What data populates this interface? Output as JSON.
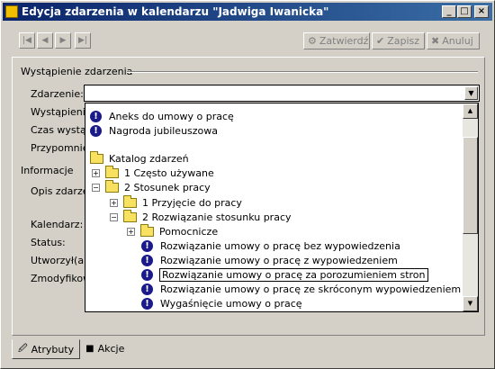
{
  "window": {
    "title": "Edycja zdarzenia w kalendarzu \"Jadwiga Iwanicka\""
  },
  "titlebar_buttons": {
    "minimize": "_",
    "maximize": "□",
    "close": "×"
  },
  "nav": {
    "first": "|◀",
    "prev": "◀",
    "next": "▶",
    "last": "▶|"
  },
  "actions": {
    "confirm": "Zatwierdź",
    "save": "Zapisz",
    "cancel": "Anuluj"
  },
  "section1": {
    "title": "Wystąpienie zdarzenia"
  },
  "fields": {
    "event": "Zdarzenie:",
    "occurrence": "Wystąpienie",
    "time": "Czas wystąp",
    "reminder": "Przypomnien"
  },
  "section2": {
    "title": "Informacje"
  },
  "info_fields": {
    "desc": "Opis zdarzen",
    "calendar": "Kalendarz:",
    "status": "Status:",
    "created": "Utworzył(a):",
    "modified": "Zmodyfikowa"
  },
  "combo": {
    "value": ""
  },
  "dropdown": {
    "top_items": [
      "Aneks do umowy o pracę",
      "Nagroda jubileuszowa"
    ],
    "catalog": "Katalog zdarzeń",
    "folder1": "1 Często używane",
    "folder2": "2 Stosunek pracy",
    "folder2_1": "1 Przyjęcie do pracy",
    "folder2_2": "2 Rozwiązanie stosunku pracy",
    "folder2_2_1": "Pomocnicze",
    "leaves": [
      "Rozwiązanie umowy o pracę bez wypowiedzenia",
      "Rozwiązanie umowy o pracę z wypowiedzeniem",
      "Rozwiązanie umowy o pracę za porozumieniem stron",
      "Rozwiązanie umowy o pracę ze skróconym wypowiedzeniem",
      "Wygaśnięcie umowy o pracę"
    ]
  },
  "tabs": {
    "attributes": "Atrybuty",
    "actions": "Akcje"
  }
}
